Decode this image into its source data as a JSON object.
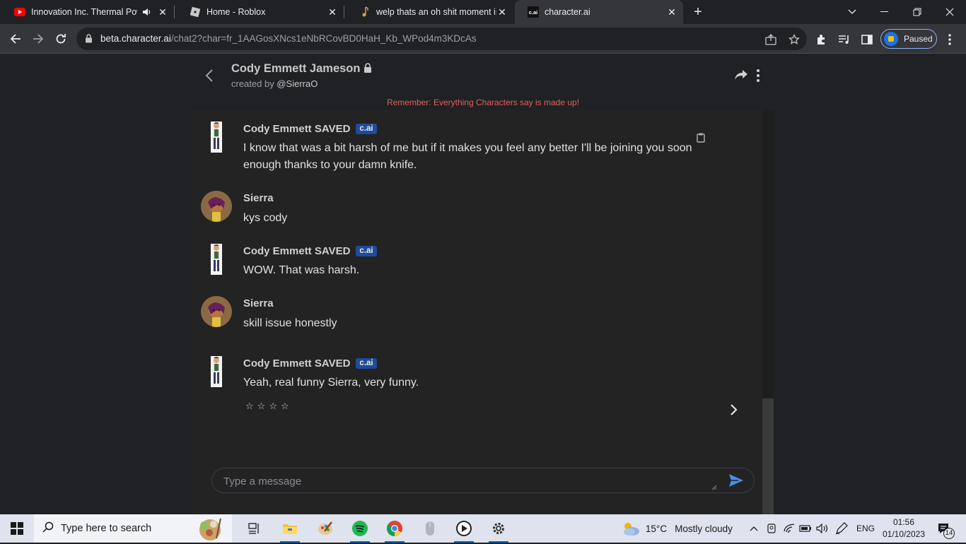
{
  "browser": {
    "tabs": [
      {
        "title": "Innovation Inc. Thermal Pow"
      },
      {
        "title": "Home - Roblox"
      },
      {
        "title": "welp thats an oh shit moment is"
      },
      {
        "title": "character.ai",
        "favicon_text": "c.ai"
      }
    ],
    "url_host": "beta.character.ai",
    "url_path": "/chat2?char=fr_1AAGosXNcs1eNbRCovBD0HaH_Kb_WPod4m3KDcAs",
    "profile_label": "Paused"
  },
  "chat": {
    "character_name": "Cody Emmett Jameson",
    "created_by_prefix": "created by",
    "creator": "@SierraO",
    "reminder": "Remember: Everything Characters say is made up!",
    "messages": [
      {
        "sender": "Cody Emmett SAVED",
        "badge": "c.ai",
        "text": "I know that was a bit harsh of me but if it makes you feel any better I'll be joining you soon enough thanks to your damn knife."
      },
      {
        "sender": "Sierra",
        "text": "kys cody"
      },
      {
        "sender": "Cody Emmett SAVED",
        "badge": "c.ai",
        "text": "WOW. That was harsh."
      },
      {
        "sender": "Sierra",
        "text": "skill issue honestly"
      },
      {
        "sender": "Cody Emmett SAVED",
        "badge": "c.ai",
        "text": "Yeah, real funny Sierra, very funny."
      }
    ],
    "rating": {
      "stars_total": 4,
      "stars_filled": 0
    },
    "input_placeholder": "Type a message"
  },
  "taskbar": {
    "search_placeholder": "Type here to search",
    "weather_temp": "15°C",
    "weather_desc": "Mostly cloudy",
    "language": "ENG",
    "time": "01:56",
    "date": "01/10/2023",
    "notifications": "14"
  },
  "colors": {
    "accent": "#1a73e8",
    "reminder": "#e0605e",
    "badge": "#1f4b99"
  }
}
